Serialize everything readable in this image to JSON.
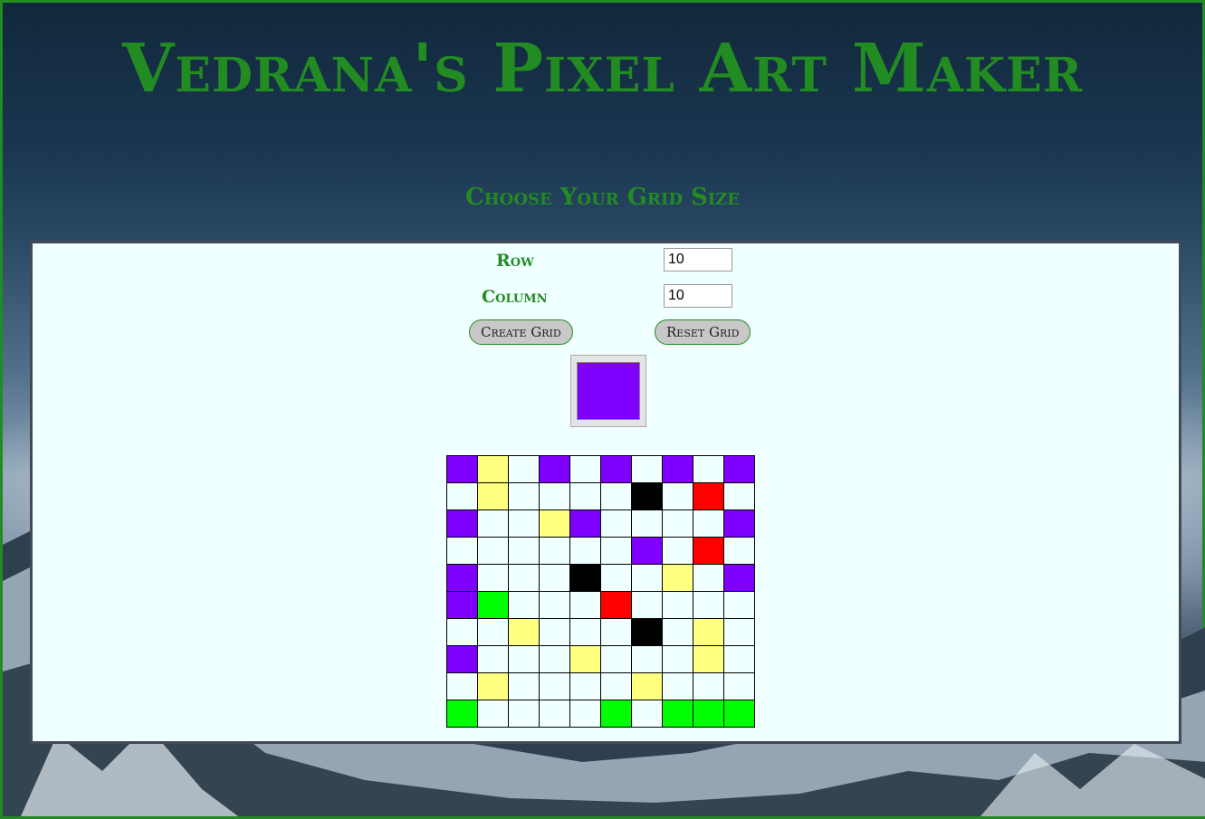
{
  "page": {
    "title": "Vedrana's Pixel Art Maker",
    "subtitle": "Choose Your Grid Size"
  },
  "form": {
    "row_label": "Row",
    "row_value": "10",
    "column_label": "Column",
    "column_value": "10",
    "create_button": "Create Grid",
    "reset_button": "Reset Grid"
  },
  "color_picker": {
    "selected_color": "#8000ff"
  },
  "palette": {
    "W": "#f0ffff",
    "P": "#8000ff",
    "Y": "#ffff80",
    "K": "#000000",
    "R": "#ff0000",
    "G": "#00ff00"
  },
  "grid": [
    [
      "P",
      "Y",
      "W",
      "P",
      "W",
      "P",
      "W",
      "P",
      "W",
      "P"
    ],
    [
      "W",
      "Y",
      "W",
      "W",
      "W",
      "W",
      "K",
      "W",
      "R",
      "W"
    ],
    [
      "P",
      "W",
      "W",
      "Y",
      "P",
      "W",
      "W",
      "W",
      "W",
      "P"
    ],
    [
      "W",
      "W",
      "W",
      "W",
      "W",
      "W",
      "P",
      "W",
      "R",
      "W"
    ],
    [
      "P",
      "W",
      "W",
      "W",
      "K",
      "W",
      "W",
      "Y",
      "W",
      "P"
    ],
    [
      "P",
      "G",
      "W",
      "W",
      "W",
      "R",
      "W",
      "W",
      "W",
      "W"
    ],
    [
      "W",
      "W",
      "Y",
      "W",
      "W",
      "W",
      "K",
      "W",
      "Y",
      "W"
    ],
    [
      "P",
      "W",
      "W",
      "W",
      "Y",
      "W",
      "W",
      "W",
      "Y",
      "W"
    ],
    [
      "W",
      "Y",
      "W",
      "W",
      "W",
      "W",
      "Y",
      "W",
      "W",
      "W"
    ],
    [
      "G",
      "W",
      "W",
      "W",
      "W",
      "G",
      "W",
      "G",
      "G",
      "G"
    ]
  ]
}
